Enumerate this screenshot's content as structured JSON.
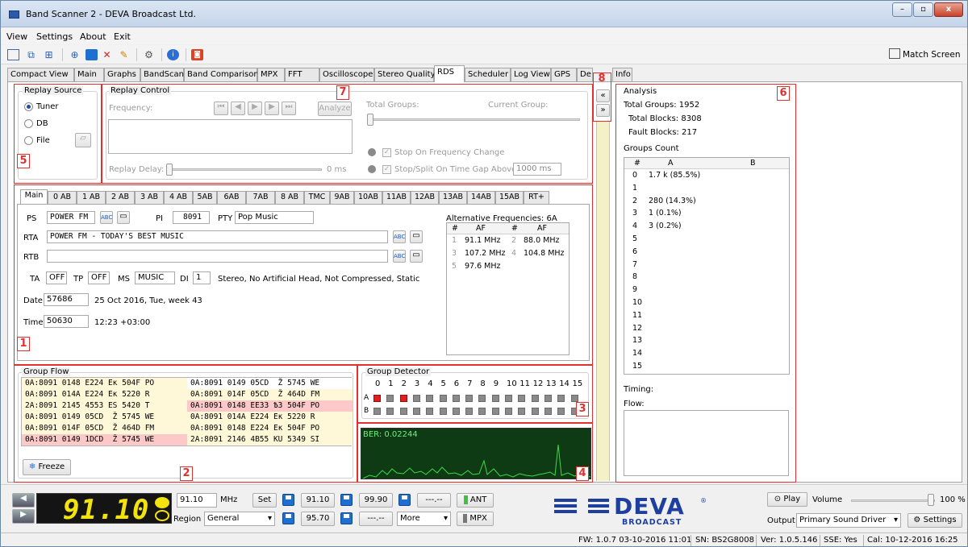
{
  "window": {
    "title": "Band Scanner 2 - DEVA Broadcast Ltd.",
    "min": "–",
    "max": "▫",
    "close": "x"
  },
  "menu": [
    "View",
    "Settings",
    "About",
    "Exit"
  ],
  "toolbar": {
    "match_screen": "Match Screen"
  },
  "tabs": [
    "Compact View",
    "Main",
    "Graphs",
    "BandScan",
    "Band Comparison",
    "MPX",
    "FFT",
    "Oscilloscope",
    "Stereo Quality",
    "RDS",
    "Scheduler",
    "Log View",
    "GPS",
    "De",
    "Info"
  ],
  "active_tab": "RDS",
  "callouts": [
    "1",
    "2",
    "3",
    "4",
    "5",
    "6",
    "7",
    "8"
  ],
  "replay_source": {
    "title": "Replay Source",
    "options": [
      "Tuner",
      "DB",
      "File"
    ],
    "selected": "Tuner"
  },
  "replay_control": {
    "title": "Replay Control",
    "frequency_label": "Frequency:",
    "analyze": "Analyze",
    "total_groups_label": "Total Groups:",
    "current_group_label": "Current Group:",
    "stop_on_freq": "Stop On Frequency Change",
    "stop_split": "Stop/Split On Time Gap Above",
    "gap_value": "1000 ms",
    "replay_delay_label": "Replay Delay:",
    "delay_value": "0 ms"
  },
  "rds": {
    "subtabs": [
      "Main",
      "0 AB",
      "1 AB",
      "2 AB",
      "3 AB",
      "4 AB",
      "5AB",
      "6AB",
      "7AB",
      "8 AB",
      "TMC",
      "9AB",
      "10AB",
      "11AB",
      "12AB",
      "13AB",
      "14AB",
      "15AB",
      "RT+"
    ],
    "ps_label": "PS",
    "ps": "POWER FM",
    "pi_label": "PI",
    "pi": "8091",
    "pty_label": "PTY",
    "pty": "Pop Music",
    "rta_label": "RTA",
    "rta": "POWER FM - TODAY'S BEST MUSIC",
    "rtb_label": "RTB",
    "rtb": "",
    "ta_label": "TA",
    "ta": "OFF",
    "tp_label": "TP",
    "tp": "OFF",
    "ms_label": "MS",
    "ms": "MUSIC",
    "di_label": "DI",
    "di": "1",
    "di_text": "Stereo, No Artificial Head, Not Compressed, Static",
    "date_label": "Date",
    "date": "57686",
    "date_text": "25 Oct 2016, Tue, week 43",
    "time_label": "Time",
    "time": "50630",
    "time_text": "12:23 +03:00",
    "af_title": "Alternative Frequencies:  6A",
    "af_headers": [
      "#",
      "AF",
      "#",
      "AF"
    ],
    "af_rows": [
      [
        "1",
        "91.1 MHz",
        "2",
        "88.0 MHz"
      ],
      [
        "3",
        "107.2 MHz",
        "4",
        "104.8 MHz"
      ],
      [
        "5",
        "97.6 MHz",
        "",
        ""
      ]
    ]
  },
  "group_flow": {
    "title": "Group Flow",
    "freeze": "Freeze",
    "rows": [
      [
        "0A:8091 0148 E224 Ек 504F PO",
        "0A:8091 0149 05CD  Ž 5745 WE"
      ],
      [
        "0A:8091 014A E224 Ек 5220 R ",
        "0A:8091 014F 05CD  Ž 464D FM"
      ],
      [
        "2A:8091 2145 4553 ES 5420 T ",
        "0A:8091 0148 EE33 Ѣ3 504F PO"
      ],
      [
        "0A:8091 0149 05CD  Ž 5745 WE",
        "0A:8091 014A E224 Ек 5220 R "
      ],
      [
        "0A:8091 014F 05CD  Ž 464D FM",
        "0A:8091 0148 E224 Ек 504F PO"
      ],
      [
        "0A:8091 0149 1DCD  Ž 5745 WE",
        "2A:8091 2146 4B55 KU 5349 SI"
      ]
    ],
    "row_colors": [
      [
        "#fff8d8",
        "#ffffff"
      ],
      [
        "#fff8d8",
        "#fff8d8"
      ],
      [
        "#fff8d8",
        "#fcc8c8"
      ],
      [
        "#fff8d8",
        "#fff8d8"
      ],
      [
        "#fff8d8",
        "#fff8d8"
      ],
      [
        "#fcc8c8",
        "#fff8d8"
      ]
    ]
  },
  "group_detector": {
    "title": "Group Detector",
    "cols": [
      "0",
      "1",
      "2",
      "3",
      "4",
      "5",
      "6",
      "7",
      "8",
      "9",
      "10",
      "11",
      "12",
      "13",
      "14",
      "15"
    ],
    "row_a_label": "A",
    "row_b_label": "B",
    "a_red": [
      0,
      2
    ]
  },
  "ber": {
    "text": "BER: 0.02244"
  },
  "analysis": {
    "title": "Analysis",
    "total_groups": "Total Groups:  1952",
    "total_blocks": "Total Blocks:  8308",
    "fault_blocks": "Fault Blocks:  217",
    "groups_count": "Groups Count",
    "headers": [
      "#",
      "A",
      "B"
    ],
    "rows": [
      [
        "0",
        "1.7 k (85.5%)"
      ],
      [
        "1",
        ""
      ],
      [
        "2",
        "280 (14.3%)"
      ],
      [
        "3",
        "1 (0.1%)"
      ],
      [
        "4",
        "3 (0.2%)"
      ],
      [
        "5",
        ""
      ],
      [
        "6",
        ""
      ],
      [
        "7",
        ""
      ],
      [
        "8",
        ""
      ],
      [
        "9",
        ""
      ],
      [
        "10",
        ""
      ],
      [
        "11",
        ""
      ],
      [
        "12",
        ""
      ],
      [
        "13",
        ""
      ],
      [
        "14",
        ""
      ],
      [
        "15",
        ""
      ]
    ],
    "timing": "Timing:",
    "flow": "Flow:"
  },
  "collapse": {
    "left": "«",
    "right": "»"
  },
  "bottom": {
    "freq_display": "91.10",
    "freq_input": "91.10",
    "mhz": "MHz",
    "set": "Set",
    "presets": [
      "91.10",
      "99.90",
      "---.--",
      "95.70",
      "---.--"
    ],
    "ant": "ANT",
    "mpx": "MPX",
    "more": "More",
    "region_label": "Region",
    "region": "General",
    "play": "Play",
    "volume_label": "Volume",
    "volume": "100 %",
    "volume_level": 0.95,
    "output_label": "Output",
    "output": "Primary Sound Driver",
    "settings": "Settings",
    "logo_text": "DEVA",
    "logo_sub": "BROADCAST",
    "logo_reg": "®"
  },
  "status": {
    "fw": "FW: 1.0.7 03-10-2016 11:01",
    "sn": "SN: BS2G8008",
    "ver": "Ver: 1.0.5.146",
    "sse": "SSE: Yes",
    "cal": "Cal: 10-12-2016 16:25"
  }
}
